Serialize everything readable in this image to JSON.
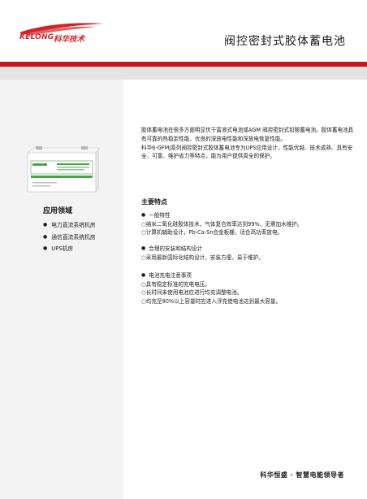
{
  "header": {
    "logo_en": "KELONG",
    "logo_cn": "科华技术",
    "title": "阀控密封式胶体蓄电池"
  },
  "sidebar": {
    "applications_title": "应用领域",
    "applications": [
      "电力直流系统机房",
      "通信直流系统机房",
      "UPS机房"
    ]
  },
  "intro": {
    "paragraph1": "胶体蓄电池在很多方面明显优于富液式电池或AGM 阀控密封式铅酸蓄电池。胶体蓄电池具有可靠的热稳定性能、优良的深放电性能和深放电恢复性能。",
    "paragraph2": "科华6-GFMJ系列阀控密封式胶体蓄电池专为UPS应用设计，性能优越、技术成熟、具有安全、可靠、维护省力等特点，能为用户提供周全的保护。"
  },
  "features": {
    "title": "主要特点",
    "groups": [
      {
        "heading": "一般特性",
        "items": [
          "○纳米二氧化硅胶体技术，气体复合效率达到99%，无需加水维护。",
          "○计算机辅助设计，Pb-Ca-Sn合金板栅，适合高功率放电。"
        ]
      },
      {
        "heading": "合理的安装和结构设计",
        "items": [
          "○采用最新国际化结构设计，安装方便，易于维护。"
        ]
      },
      {
        "heading": "电池充电注意事项",
        "items": [
          "○具有稳定标准的充电电压。",
          "○长时间未使用电池应进行均充调整电池。",
          "○均充至90%以上容量时应进入浮充使电池达到最大容量。"
        ]
      }
    ]
  },
  "footer": {
    "slogan": "科华恒盛 · 智慧电能领导者"
  },
  "colors": {
    "brand_red": "#c8161d",
    "band_gray": "#e4e4e4",
    "sidebar_bg": "#f3f3f3"
  }
}
